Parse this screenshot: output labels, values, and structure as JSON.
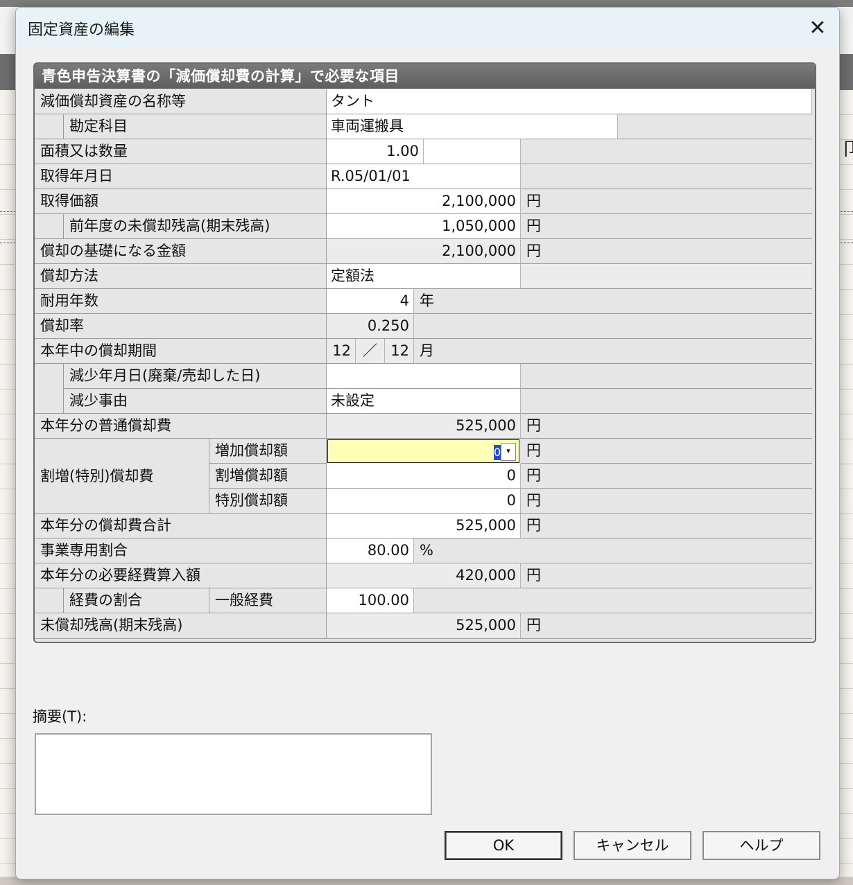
{
  "window": {
    "title": "固定資産の編集",
    "close_label": "✕"
  },
  "background": {
    "right_text": "卩"
  },
  "section": {
    "header": "青色申告決算書の「減価償却費の計算」で必要な項目"
  },
  "fields": {
    "asset_name": {
      "label": "減価償却資産の名称等",
      "value": "タント"
    },
    "account": {
      "label": "勘定科目",
      "value": "車両運搬具"
    },
    "quantity": {
      "label": "面積又は数量",
      "value": "1.00"
    },
    "acquired_date": {
      "label": "取得年月日",
      "value": "R.05/01/01"
    },
    "acquisition_cost": {
      "label": "取得価額",
      "value": "2,100,000",
      "unit": "円"
    },
    "prev_balance": {
      "label": "前年度の未償却残高(期末残高)",
      "value": "1,050,000",
      "unit": "円"
    },
    "depreciation_base": {
      "label": "償却の基礎になる金額",
      "value": "2,100,000",
      "unit": "円"
    },
    "method": {
      "label": "償却方法",
      "value": "定額法"
    },
    "useful_life": {
      "label": "耐用年数",
      "value": "4",
      "unit": "年"
    },
    "rate": {
      "label": "償却率",
      "value": "0.250"
    },
    "period": {
      "label": "本年中の償却期間",
      "months": "12",
      "separator": "／",
      "total": "12",
      "unit": "月"
    },
    "disposal_date": {
      "label": "減少年月日(廃棄/売却した日)",
      "value": ""
    },
    "disposal_reason": {
      "label": "減少事由",
      "value": "未設定"
    },
    "normal_depreciation": {
      "label": "本年分の普通償却費",
      "value": "525,000",
      "unit": "円"
    },
    "special": {
      "label": "割増(特別)償却費",
      "increase": {
        "label": "増加償却額",
        "value": "0",
        "unit": "円"
      },
      "premium": {
        "label": "割増償却額",
        "value": "0",
        "unit": "円"
      },
      "special": {
        "label": "特別償却額",
        "value": "0",
        "unit": "円"
      }
    },
    "total_depreciation": {
      "label": "本年分の償却費合計",
      "value": "525,000",
      "unit": "円"
    },
    "business_ratio": {
      "label": "事業専用割合",
      "value": "80.00",
      "unit": "%"
    },
    "expense_amount": {
      "label": "本年分の必要経費算入額",
      "value": "420,000",
      "unit": "円"
    },
    "expense_ratio": {
      "label": "経費の割合",
      "sublabel": "一般経費",
      "value": "100.00"
    },
    "ending_balance": {
      "label": "未償却残高(期末残高)",
      "value": "525,000",
      "unit": "円"
    }
  },
  "memo": {
    "label": "摘要(T):",
    "value": ""
  },
  "buttons": {
    "ok": "OK",
    "cancel": "キャンセル",
    "help": "ヘルプ"
  }
}
